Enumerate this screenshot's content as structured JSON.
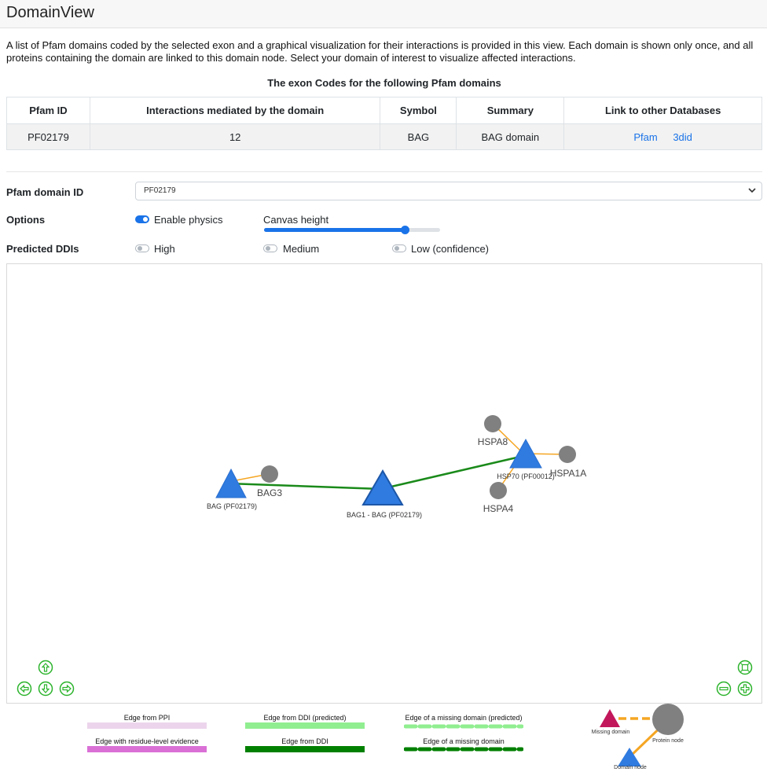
{
  "header": {
    "title": "DomainView"
  },
  "intro": "A list of Pfam domains coded by the selected exon and a graphical visualization for their interactions is provided in this view. Each domain is shown only once, and all proteins containing the domain are linked to this domain node. Select your domain of interest to visualize affected interactions.",
  "table": {
    "caption": "The exon Codes for the following Pfam domains",
    "headers": [
      "Pfam ID",
      "Interactions mediated by the domain",
      "Symbol",
      "Summary",
      "Link to other Databases"
    ],
    "rows": [
      {
        "pfam_id": "PF02179",
        "interactions": "12",
        "symbol": "BAG",
        "summary": "BAG domain",
        "links": [
          "Pfam",
          "3did"
        ]
      }
    ]
  },
  "controls": {
    "pfam_label": "Pfam domain ID",
    "pfam_value": "PF02179",
    "options_label": "Options",
    "physics_label": "Enable physics",
    "physics_enabled": true,
    "canvas_height_label": "Canvas height",
    "canvas_height_level": 0.8,
    "predicted_label": "Predicted DDIs",
    "high_label": "High",
    "medium_label": "Medium",
    "low_label": "Low (confidence)",
    "high_enabled": false,
    "medium_enabled": false,
    "low_enabled": false
  },
  "network": {
    "colors": {
      "domain": "#2f7be0",
      "protein": "#808080",
      "ddi_edge": "#1a8a1a",
      "ppi_edge": "#f5a623",
      "missing_domain": "#c2185b",
      "nav": "#2bb32b"
    },
    "node_labels": {
      "bag": "BAG (PF02179)",
      "bag3": "BAG3",
      "bag1": "BAG1 - BAG (PF02179)",
      "hspa8": "HSPA8",
      "hsp70": "HSP70 (PF00012)",
      "hspa1a": "HSPA1A",
      "hspa4": "HSPA4"
    }
  },
  "legend": {
    "ppi": "Edge from PPI",
    "residue": "Edge with residue-level evidence",
    "ddi_pred": "Edge from DDI (predicted)",
    "ddi": "Edge from DDI",
    "missing_pred": "Edge of a missing domain (predicted)",
    "missing": "Edge of a missing domain",
    "missing_node": "Missing domain",
    "protein_node": "Protein node",
    "domain_node": "Domain node",
    "colors": {
      "ppi": "#ecd5ec",
      "residue": "#da70d6",
      "ddi_pred": "#90ee90",
      "ddi": "#008000",
      "missing_pred": "#90ee90",
      "missing": "#008000",
      "missing_node": "#c2185b",
      "protein_node": "#808080",
      "domain_node": "#2f7be0",
      "orange": "#f5a623"
    }
  }
}
